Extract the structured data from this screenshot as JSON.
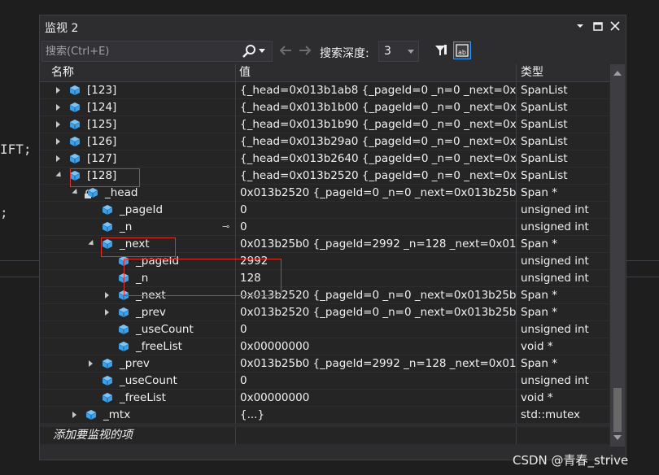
{
  "editor": {
    "code_fragments": [
      "IFT;",
      ";"
    ]
  },
  "window": {
    "title": "监视 2",
    "controls": [
      "dropdown",
      "maximize",
      "close"
    ]
  },
  "toolbar": {
    "search_placeholder": "搜索(Ctrl+E)",
    "depth_label": "搜索深度:",
    "depth_value": "3"
  },
  "columns": {
    "name": "名称",
    "value": "值",
    "type": "类型"
  },
  "rows": [
    {
      "indent": 1,
      "exp": "closed",
      "icon": "cube",
      "name": "[123]",
      "value": "{_head=0x013b1ab8 {_pageId=0 _n=0 _next=0x01...",
      "type": "SpanList"
    },
    {
      "indent": 1,
      "exp": "closed",
      "icon": "cube",
      "name": "[124]",
      "value": "{_head=0x013b1b00 {_pageId=0 _n=0 _next=0x01...",
      "type": "SpanList"
    },
    {
      "indent": 1,
      "exp": "closed",
      "icon": "cube",
      "name": "[125]",
      "value": "{_head=0x013b1b90 {_pageId=0 _n=0 _next=0x01...",
      "type": "SpanList"
    },
    {
      "indent": 1,
      "exp": "closed",
      "icon": "cube",
      "name": "[126]",
      "value": "{_head=0x013b29a0 {_pageId=0 _n=0 _next=0x01...",
      "type": "SpanList"
    },
    {
      "indent": 1,
      "exp": "closed",
      "icon": "cube",
      "name": "[127]",
      "value": "{_head=0x013b2640 {_pageId=0 _n=0 _next=0x01...",
      "type": "SpanList"
    },
    {
      "indent": 1,
      "exp": "open",
      "icon": "cube",
      "name": "[128]",
      "value": "{_head=0x013b2520 {_pageId=0 _n=0 _next=0x01...",
      "type": "SpanList"
    },
    {
      "indent": 2,
      "exp": "open",
      "icon": "lockcube",
      "name": "_head",
      "value": "0x013b2520 {_pageId=0 _n=0 _next=0x013b25b0 ...",
      "type": "Span *"
    },
    {
      "indent": 3,
      "exp": "none",
      "icon": "cube",
      "name": "_pageId",
      "value": "0",
      "type": "unsigned int"
    },
    {
      "indent": 3,
      "exp": "none",
      "icon": "cube",
      "name": "_n",
      "value": "0",
      "type": "unsigned int",
      "pin": true
    },
    {
      "indent": 3,
      "exp": "open",
      "icon": "cube",
      "name": "_next",
      "value": "0x013b25b0 {_pageId=2992 _n=128 _next=0x013...",
      "type": "Span *"
    },
    {
      "indent": 4,
      "exp": "none",
      "icon": "cube",
      "name": "_pageId",
      "value": "2992",
      "type": "unsigned int"
    },
    {
      "indent": 4,
      "exp": "none",
      "icon": "cube",
      "name": "_n",
      "value": "128",
      "type": "unsigned int"
    },
    {
      "indent": 4,
      "exp": "closed",
      "icon": "cube",
      "name": "_next",
      "value": "0x013b2520 {_pageId=0 _n=0 _next=0x013b25b0 ...",
      "type": "Span *"
    },
    {
      "indent": 4,
      "exp": "closed",
      "icon": "cube",
      "name": "_prev",
      "value": "0x013b2520 {_pageId=0 _n=0 _next=0x013b25b0 ...",
      "type": "Span *"
    },
    {
      "indent": 4,
      "exp": "none",
      "icon": "cube",
      "name": "_useCount",
      "value": "0",
      "type": "unsigned int"
    },
    {
      "indent": 4,
      "exp": "none",
      "icon": "cube",
      "name": "_freeList",
      "value": "0x00000000",
      "type": "void *"
    },
    {
      "indent": 3,
      "exp": "closed",
      "icon": "cube",
      "name": "_prev",
      "value": "0x013b25b0 {_pageId=2992 _n=128 _next=0x013...",
      "type": "Span *"
    },
    {
      "indent": 3,
      "exp": "none",
      "icon": "cube",
      "name": "_useCount",
      "value": "0",
      "type": "unsigned int"
    },
    {
      "indent": 3,
      "exp": "none",
      "icon": "cube",
      "name": "_freeList",
      "value": "0x00000000",
      "type": "void *"
    },
    {
      "indent": 2,
      "exp": "closed",
      "icon": "cube",
      "name": "_mtx",
      "value": "{...}",
      "type": "std::mutex"
    }
  ],
  "add_watch_label": "添加要监视的项",
  "watermark": "CSDN @青春_strive",
  "colors": {
    "highlight": "#e0312d",
    "cube": "#3c9fe8",
    "accent": "#3399ff"
  }
}
